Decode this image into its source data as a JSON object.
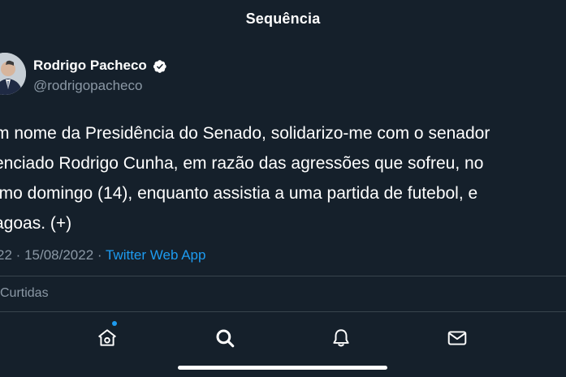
{
  "header": {
    "title": "Sequência"
  },
  "author": {
    "name": "Rodrigo Pacheco",
    "handle": "@rodrigopacheco",
    "verified": true
  },
  "tweet": {
    "lines": [
      "m nome da Presidência do Senado, solidarizo-me com o senador",
      "enciado Rodrigo Cunha, em razão das agressões que sofreu, no",
      "imo domingo (14), enquanto assistia a uma partida de futebol, e",
      "agoas. (+)"
    ]
  },
  "meta": {
    "time_fragment": "22",
    "separator": "·",
    "date": "15/08/2022",
    "source": "Twitter Web App"
  },
  "stats": {
    "likes_label": "Curtidas"
  },
  "tab_bar": {
    "tabs": [
      {
        "icon": "home-icon",
        "active": false,
        "has_notification_dot": true
      },
      {
        "icon": "search-icon",
        "active": true
      },
      {
        "icon": "bell-icon",
        "active": false
      },
      {
        "icon": "mail-icon",
        "active": false
      }
    ]
  },
  "colors": {
    "background": "#15202b",
    "text": "#ffffff",
    "secondary_text": "#8b98a5",
    "accent": "#1d9bf0",
    "divider": "#38444d"
  }
}
